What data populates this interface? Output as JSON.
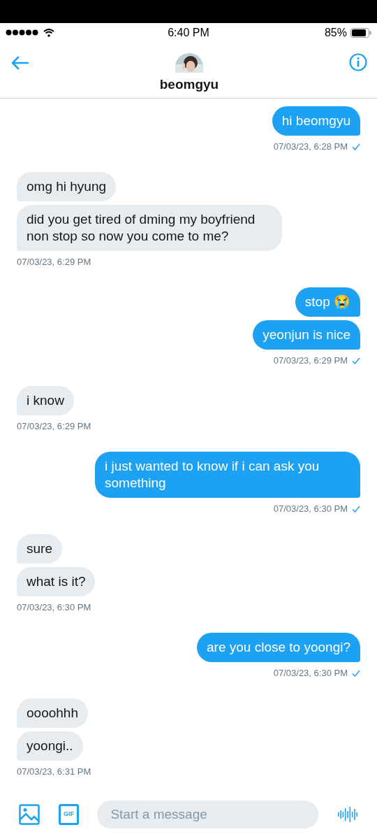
{
  "status_bar": {
    "time": "6:40 PM",
    "battery": "85%"
  },
  "header": {
    "name": "beomgyu"
  },
  "groups": [
    {
      "kind": "sent",
      "messages": [
        "hi beomgyu"
      ],
      "time": "07/03/23, 6:28 PM"
    },
    {
      "kind": "received",
      "messages": [
        "omg hi hyung",
        "did you get tired of dming my boyfriend non stop so now you come to me?"
      ],
      "time": "07/03/23, 6:29 PM"
    },
    {
      "kind": "sent",
      "messages": [
        "stop 😭",
        "yeonjun is nice"
      ],
      "time": "07/03/23, 6:29 PM"
    },
    {
      "kind": "received",
      "messages": [
        "i know"
      ],
      "time": "07/03/23, 6:29 PM"
    },
    {
      "kind": "sent",
      "messages": [
        "i just wanted to know if i can ask you something"
      ],
      "time": "07/03/23, 6:30 PM"
    },
    {
      "kind": "received",
      "messages": [
        "sure",
        "what is it?"
      ],
      "time": "07/03/23, 6:30 PM"
    },
    {
      "kind": "sent",
      "messages": [
        "are you close to yoongi?"
      ],
      "time": "07/03/23, 6:30 PM"
    },
    {
      "kind": "received",
      "messages": [
        "oooohhh",
        "yoongi.."
      ],
      "time": "07/03/23, 6:31 PM"
    }
  ],
  "composer": {
    "gif_label": "GIF",
    "placeholder": "Start a message"
  }
}
